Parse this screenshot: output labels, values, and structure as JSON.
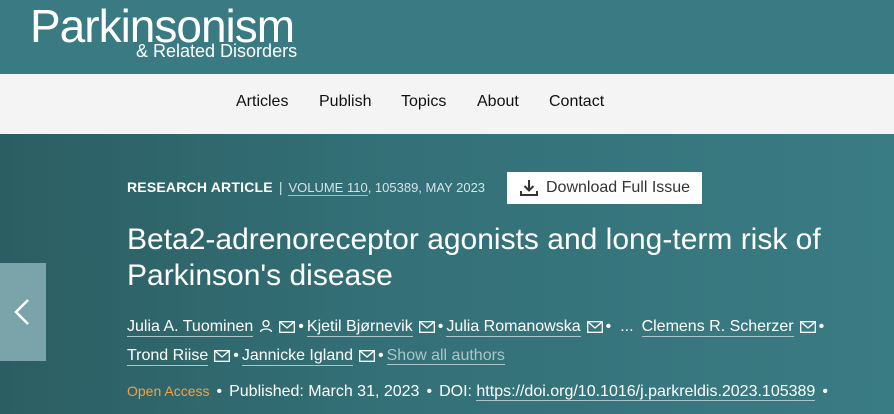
{
  "journal": {
    "logo_main": "Parkinsonism",
    "logo_sub": "& Related Disorders"
  },
  "nav": {
    "items": [
      "Articles",
      "Publish",
      "Topics",
      "About",
      "Contact"
    ]
  },
  "article": {
    "type": "RESEARCH ARTICLE",
    "volume_link": "VOLUME 110",
    "volume_rest": ", 105389, MAY 2023",
    "download_label": "Download Full Issue",
    "title": "Beta2-adrenoreceptor agonists and long-term risk of Parkinson's disease",
    "authors": [
      "Julia A. Tuominen",
      "Kjetil Bjørnevik",
      "Julia Romanowska",
      "Clemens R. Scherzer",
      "Trond Riise",
      "Jannicke Igland"
    ],
    "ellipsis": "...",
    "show_all": "Show all authors",
    "open_access": "Open Access",
    "published": "Published: March 31, 2023",
    "doi_label": "DOI:",
    "doi_link": "https://doi.org/10.1016/j.parkreldis.2023.105389"
  },
  "colors": {
    "header_bg": "#3a7a82",
    "hero_bg": "#336f76",
    "nav_bg": "#f4f4f4",
    "open_access": "#f0a347"
  },
  "icons": [
    "person-icon",
    "email-icon",
    "download-icon",
    "chevron-left-icon"
  ]
}
